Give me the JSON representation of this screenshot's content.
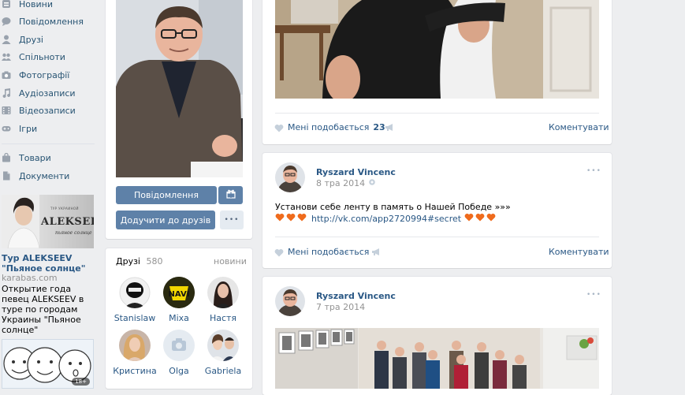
{
  "nav": {
    "items": [
      {
        "label": "Новини",
        "icon": "news-icon"
      },
      {
        "label": "Повідомлення",
        "icon": "messages-icon"
      },
      {
        "label": "Друзі",
        "icon": "friends-icon"
      },
      {
        "label": "Спільноти",
        "icon": "communities-icon"
      },
      {
        "label": "Фотографії",
        "icon": "photos-icon"
      },
      {
        "label": "Аудіозаписи",
        "icon": "audio-icon"
      },
      {
        "label": "Відеозаписи",
        "icon": "video-icon"
      },
      {
        "label": "Ігри",
        "icon": "games-icon"
      }
    ],
    "items2": [
      {
        "label": "Товари",
        "icon": "market-icon"
      },
      {
        "label": "Документи",
        "icon": "documents-icon"
      }
    ]
  },
  "ad": {
    "banner_top": "ТУР УКРАИНОЙ",
    "banner_name": "ALEKSEEV",
    "banner_sub": "пьяное солнце",
    "title": "Тур ALEKSEEV \"Пьяное солнце\"",
    "domain": "karabas.com",
    "description": "Открытие года певец ALEKSEEV в туре по городам Украины \"Пьяное солнце\"",
    "age_badge": "18+"
  },
  "profile": {
    "message_button": "Повідомлення",
    "add_friend_button": "Додучити до друзів",
    "more_dots": "•••"
  },
  "friends": {
    "title": "Друзі",
    "count": "580",
    "link": "новини",
    "list": [
      {
        "name": "Stanislaw"
      },
      {
        "name": "Міха"
      },
      {
        "name": "Настя"
      },
      {
        "name": "Кристина"
      },
      {
        "name": "Olga"
      },
      {
        "name": "Gabriela"
      }
    ]
  },
  "post0": {
    "like_label": "Мені подобається",
    "like_count": "23",
    "comment_label": "Коментувати"
  },
  "post1": {
    "author": "Ryszard Vincenc",
    "date": "8 тра 2014",
    "text": "Установи себе ленту в память о Нашей Победе »»»",
    "link": "http://vk.com/app2720994#secret",
    "like_label": "Мені подобається",
    "comment_label": "Коментувати",
    "menu": "•••"
  },
  "post2": {
    "author": "Ryszard Vincenc",
    "date": "7 тра 2014",
    "menu": "•••"
  },
  "colors": {
    "accent": "#5e81a8",
    "link": "#2a5885",
    "bg": "#edeef0"
  }
}
